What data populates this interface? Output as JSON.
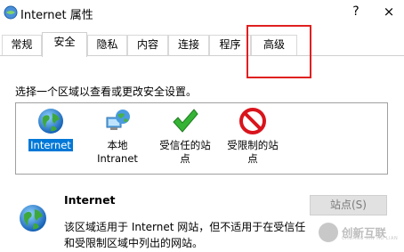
{
  "window": {
    "title": "Internet 属性",
    "help_label": "?",
    "close_label": "×"
  },
  "tabs": [
    {
      "label": "常规"
    },
    {
      "label": "安全",
      "active": true
    },
    {
      "label": "隐私"
    },
    {
      "label": "内容"
    },
    {
      "label": "连接"
    },
    {
      "label": "程序"
    },
    {
      "label": "高级",
      "highlighted": true
    }
  ],
  "security": {
    "instruction": "选择一个区域以查看或更改安全设置。",
    "zones": [
      {
        "line1": "Internet",
        "line2": "",
        "icon": "globe-icon",
        "selected": true
      },
      {
        "line1": "本地",
        "line2": "Intranet",
        "icon": "local-intranet-icon"
      },
      {
        "line1": "受信任的站",
        "line2": "点",
        "icon": "checkmark-icon"
      },
      {
        "line1": "受限制的站",
        "line2": "点",
        "icon": "restricted-icon"
      }
    ],
    "detail": {
      "title": "Internet",
      "desc_line1": "该区域适用于 Internet 网站，但不适用于在受信任",
      "desc_line2": "和受限制区域中列出的网站。"
    },
    "sites_button": "站点(S)"
  },
  "watermark": {
    "text": "创新互联",
    "subtext": "CHUANG XIN HU LIAN"
  },
  "colors": {
    "selection": "#0078d7",
    "highlight_box": "#e02020"
  }
}
